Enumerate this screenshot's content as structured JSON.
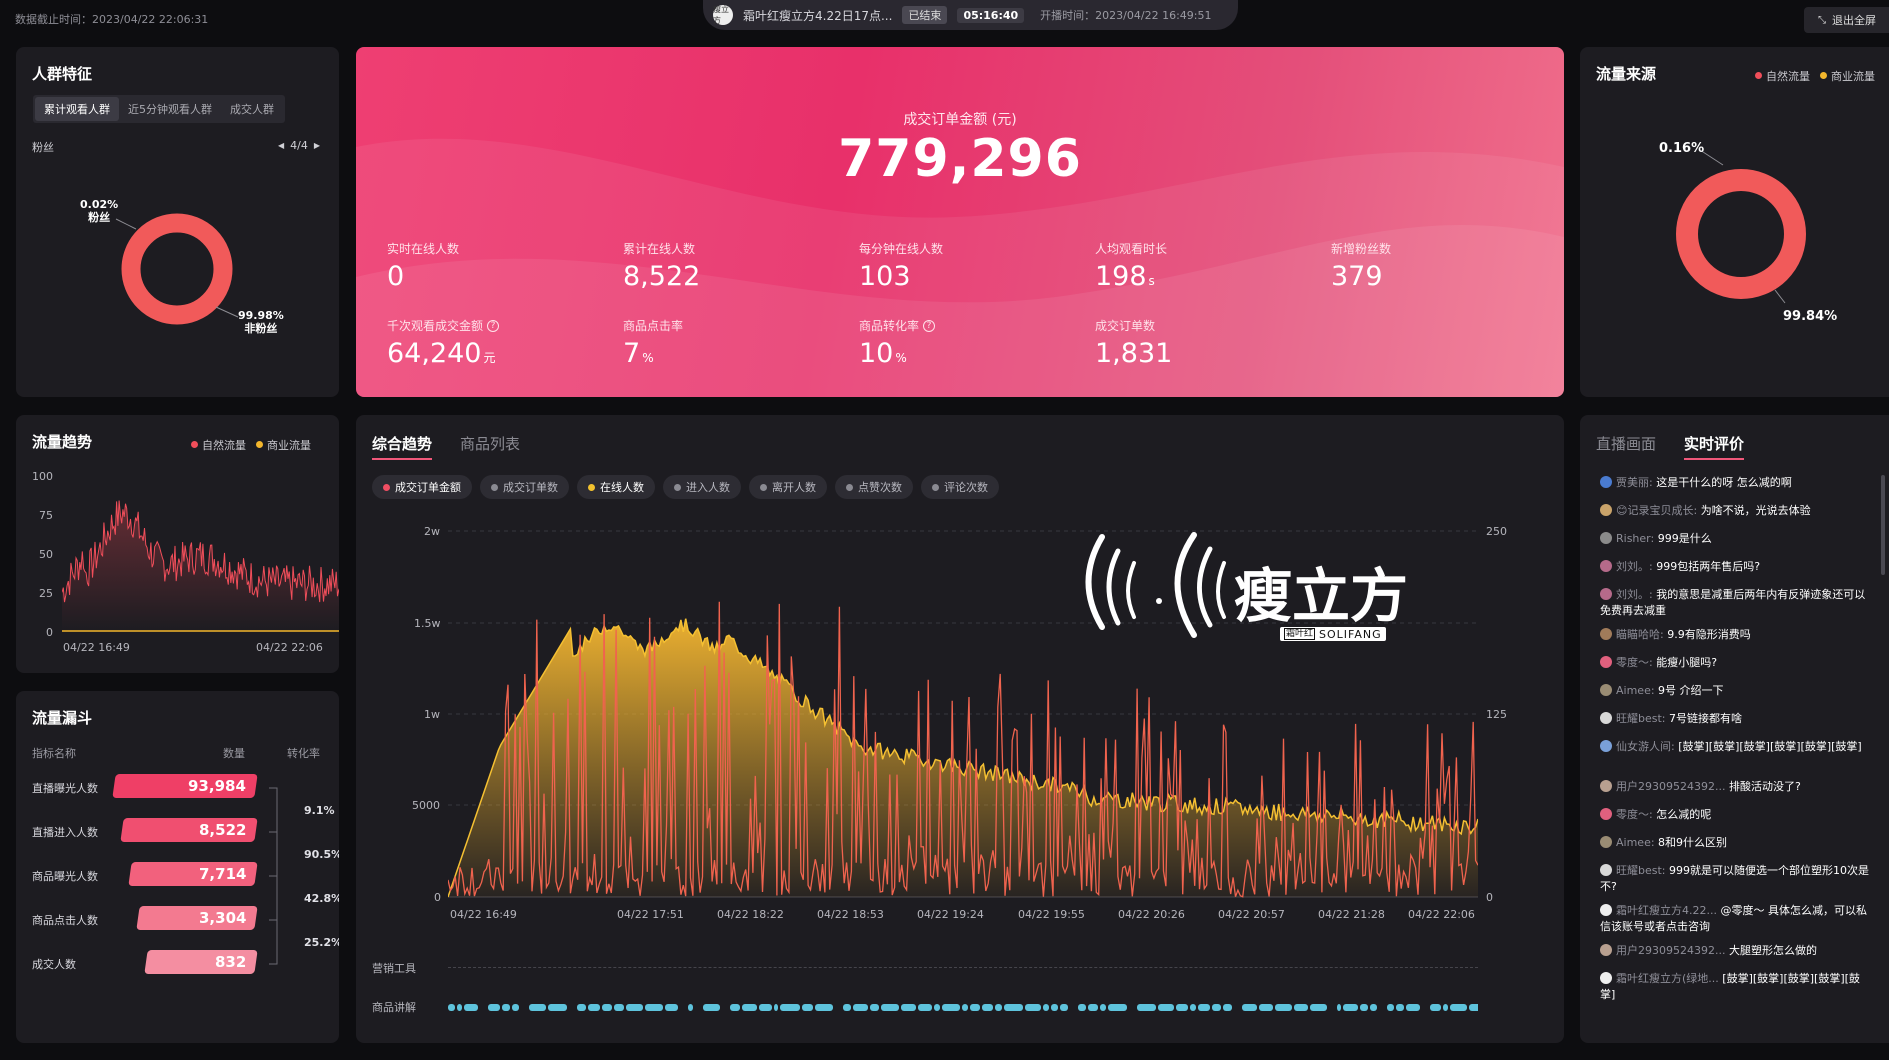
{
  "topbar": {
    "data_cutoff": "数据截止时间：2023/04/22 22:06:31",
    "avatar_text": "瘦立方",
    "live_title": "霜叶红瘦立方4.22日17点...",
    "live_status": "已结束",
    "live_duration": "05:16:40",
    "live_start": "开播时间：2023/04/22 16:49:51",
    "exit_label": "退出全屏"
  },
  "crowd": {
    "title": "人群特征",
    "tabs": [
      "累计观看人群",
      "近5分钟观看人群",
      "成交人群"
    ],
    "section": "粉丝",
    "pager": "4/4",
    "fans_pct": "0.02%",
    "fans_label": "粉丝",
    "nonfans_pct": "99.98%",
    "nonfans_label": "非粉丝",
    "donut": {
      "fans": 0.02,
      "nonfans": 99.98
    }
  },
  "hero": {
    "label": "成交订单金额 (元)",
    "value": "779,296",
    "metrics": [
      {
        "label": "实时在线人数",
        "value": "0",
        "unit": "",
        "help": false
      },
      {
        "label": "累计在线人数",
        "value": "8,522",
        "unit": "",
        "help": false
      },
      {
        "label": "每分钟在线人数",
        "value": "103",
        "unit": "",
        "help": false
      },
      {
        "label": "人均观看时长",
        "value": "198",
        "unit": "s",
        "help": false
      },
      {
        "label": "新增粉丝数",
        "value": "379",
        "unit": "",
        "help": false
      },
      {
        "label": "千次观看成交金额",
        "value": "64,240",
        "unit": "元",
        "help": true
      },
      {
        "label": "商品点击率",
        "value": "7",
        "unit": "%",
        "help": false
      },
      {
        "label": "商品转化率",
        "value": "10",
        "unit": "%",
        "help": true
      },
      {
        "label": "成交订单数",
        "value": "1,831",
        "unit": "",
        "help": false
      }
    ]
  },
  "traffic_source": {
    "title": "流量来源",
    "legend": [
      "自然流量",
      "商业流量"
    ],
    "commercial_pct": "0.16%",
    "natural_pct": "99.84%",
    "donut": {
      "commercial": 0.16,
      "natural": 99.84
    }
  },
  "traffic_trend": {
    "title": "流量趋势",
    "legend": [
      "自然流量",
      "商业流量"
    ],
    "yticks": [
      "100",
      "75",
      "50",
      "25",
      "0"
    ],
    "xticks": [
      "04/22 16:49",
      "04/22 22:06"
    ]
  },
  "funnel": {
    "title": "流量漏斗",
    "head_name": "指标名称",
    "head_count": "数量",
    "head_rate": "转化率",
    "rows": [
      {
        "label": "直播曝光人数",
        "value": "93,984"
      },
      {
        "label": "直播进入人数",
        "value": "8,522"
      },
      {
        "label": "商品曝光人数",
        "value": "7,714"
      },
      {
        "label": "商品点击人数",
        "value": "3,304"
      },
      {
        "label": "成交人数",
        "value": "832"
      }
    ],
    "rates": [
      "9.1%",
      "90.5%",
      "42.8%",
      "25.2%"
    ]
  },
  "main_trend": {
    "tabs": [
      "综合趋势",
      "商品列表"
    ],
    "chips": [
      "成交订单金额",
      "成交订单数",
      "在线人数",
      "进入人数",
      "离开人数",
      "点赞次数",
      "评论次数"
    ],
    "y_left": [
      "2w",
      "1.5w",
      "1w",
      "5000",
      "0"
    ],
    "y_right": [
      "250",
      "125",
      "0"
    ],
    "xticks": [
      "04/22 16:49",
      "04/22 17:51",
      "04/22 18:22",
      "04/22 18:53",
      "04/22 19:24",
      "04/22 19:55",
      "04/22 20:26",
      "04/22 20:57",
      "04/22 21:28",
      "04/22 22:06"
    ],
    "row_marketing": "营销工具",
    "row_explain": "商品讲解",
    "brand_name": "瘦立方",
    "brand_sub": "霜叶红",
    "brand_en": "SOLIFANG"
  },
  "comments": {
    "tabs": [
      "直播画面",
      "实时评价"
    ],
    "items": [
      {
        "name": "贾美丽:",
        "text": "这是干什么的呀 怎么减的啊",
        "color": "#4a7bd0"
      },
      {
        "name": "😊记录宝贝成长:",
        "text": "为啥不说，光说去体验",
        "color": "#c9a36a"
      },
      {
        "name": "Risher:",
        "text": "999是什么",
        "color": "#8b8b8b"
      },
      {
        "name": "刘刘。:",
        "text": "999包括两年售后吗?",
        "color": "#b56a8a"
      },
      {
        "name": "刘刘。:",
        "text": "我的意思是减重后两年内有反弹迹象还可以免费再去减重",
        "color": "#b56a8a"
      },
      {
        "name": "瞄瞄哈哈:",
        "text": "9.9有隐形消费吗",
        "color": "#a07b5a"
      },
      {
        "name": "零度～:",
        "text": "能瘦小腿吗?",
        "color": "#e0607e"
      },
      {
        "name": "Aimee:",
        "text": "9号 介绍一下",
        "color": "#9a8c74"
      },
      {
        "name": "旺耀best:",
        "text": "7号链接都有啥",
        "color": "#d8d8d8"
      },
      {
        "name": "仙女游人间:",
        "text": "[鼓掌][鼓掌][鼓掌][鼓掌][鼓掌][鼓掌]",
        "color": "#7aa0d8"
      },
      {
        "name": "用户29309524392...",
        "text": "排酸活动没了?",
        "color": "#b8a090"
      },
      {
        "name": "零度～:",
        "text": "怎么减的呢",
        "color": "#e0607e"
      },
      {
        "name": "Aimee:",
        "text": "8和9什么区别",
        "color": "#9a8c74"
      },
      {
        "name": "旺耀best:",
        "text": "999就是可以随便选一个部位塑形10次是不?",
        "color": "#d8d8d8"
      },
      {
        "name": "霜叶红瘦立方4.22...",
        "text": "@零度～ 具体怎么减，可以私信该账号或者点击咨询",
        "color": "#eeeeee"
      },
      {
        "name": "用户29309524392...",
        "text": "大腿塑形怎么做的",
        "color": "#b8a090"
      },
      {
        "name": "霜叶红瘦立方(绿地...",
        "text": "[鼓掌][鼓掌][鼓掌][鼓掌][鼓掌]",
        "color": "#eeeeee"
      }
    ]
  },
  "colors": {
    "accent": "#f0577a",
    "donut_red": "#f15a5a",
    "natural": "#f04e5a",
    "commercial": "#f3b62c",
    "area_yellow": "#f5b731",
    "line_red": "#f0634e",
    "explain_bar": "#5ec3dc"
  }
}
